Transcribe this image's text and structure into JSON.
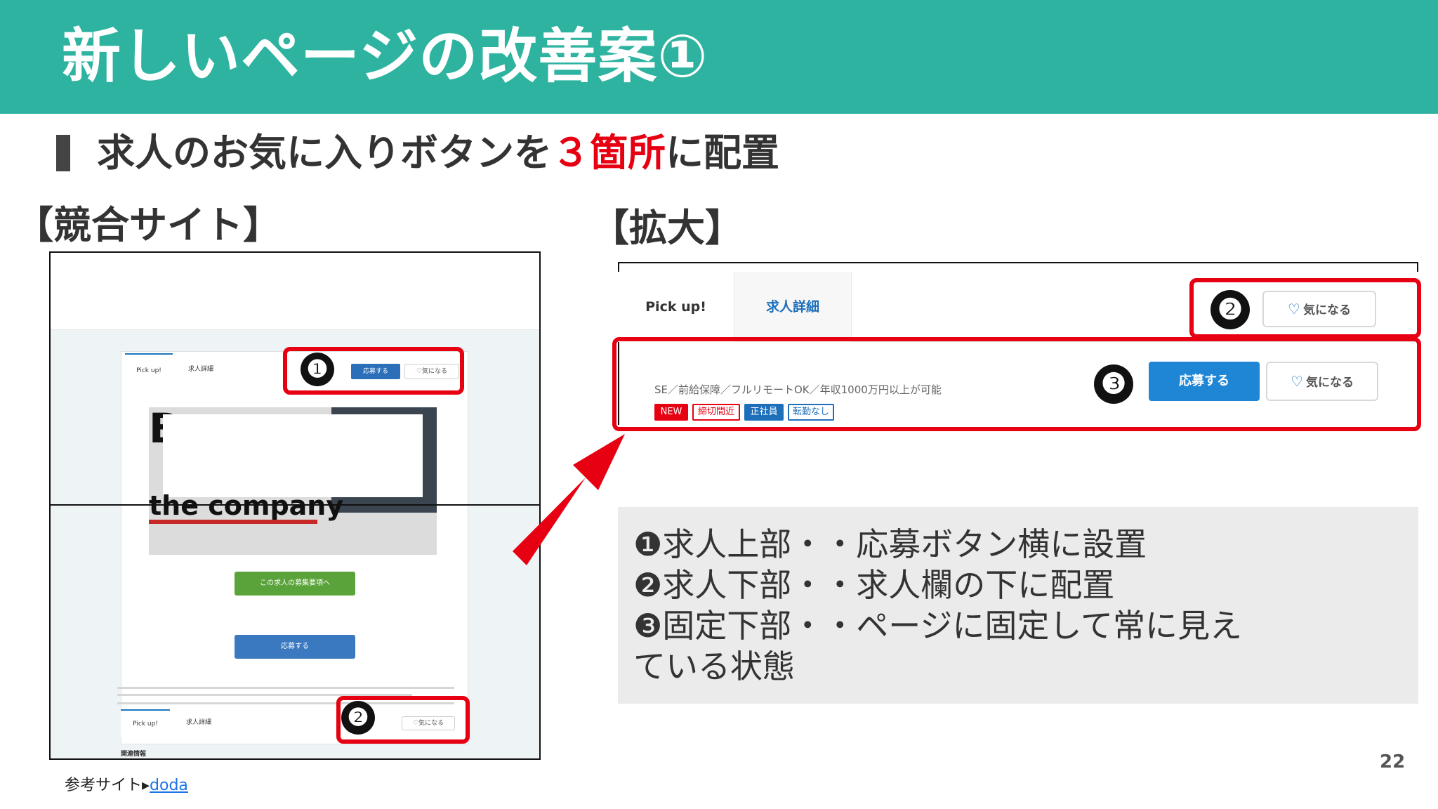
{
  "header": {
    "title": "新しいページの改善案①"
  },
  "subtitle": {
    "before": "求人のお気に入りボタンを",
    "accent": "３箇所",
    "after": "に配置"
  },
  "labels": {
    "competitor": "【競合サイト】",
    "zoom": "【拡大】"
  },
  "left_mock": {
    "tab_pickup": "Pick up!",
    "tab_detail": "求人詳細",
    "apply": "応募する",
    "favorite": "♡気になる",
    "hero_letter": "B",
    "hero_company": "the company",
    "green_button": "この求人の募集要項へ",
    "blue_button": "応募する",
    "bottom_tab_pickup": "Pick up!",
    "bottom_tab_detail": "求人詳細",
    "bottom_favorite": "♡気になる",
    "related": "関連情報"
  },
  "right_mock": {
    "tab_pickup": "Pick up!",
    "tab_detail": "求人詳細",
    "favorite_top": "気になる",
    "job_text": "SE／前給保障／フルリモートOK／年収1000万円以上が可能",
    "tags": [
      "NEW",
      "締切間近",
      "正社員",
      "転勤なし"
    ],
    "apply": "応募する",
    "favorite_bottom": "気になる"
  },
  "badges": [
    "❶",
    "❷",
    "❸"
  ],
  "notes": [
    "❶求人上部・・応募ボタン横に設置",
    "❷求人下部・・求人欄の下に配置",
    "❸固定下部・・ページに固定して常に見え",
    "ている状態"
  ],
  "page_number": "22",
  "reference": {
    "label": "参考サイト▸",
    "link": "doda"
  },
  "colors": {
    "header": "#2eb3a0",
    "accent": "#e60012",
    "apply": "#1f86d6"
  }
}
